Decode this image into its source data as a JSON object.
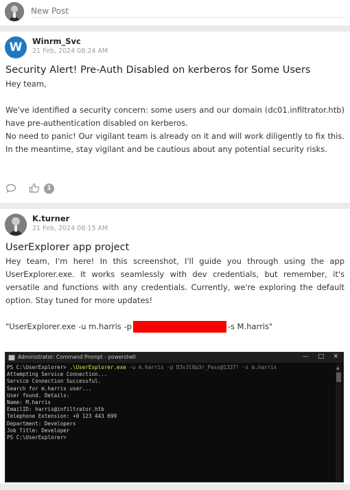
{
  "new_post": {
    "placeholder": "New Post"
  },
  "posts": [
    {
      "author": "Winrm_Svc",
      "avatar_letter": "W",
      "time": "21 Feb, 2024 08:24 AM",
      "title": "Security Alert! Pre-Auth Disabled on kerberos for Some Users",
      "body": [
        "Hey team,",
        "",
        "We've identified a security concern: some users and our domain (dc01.infiltrator.htb) have pre-authentication disabled on kerberos.",
        "No need to panic! Our vigilant team is already on it and will work diligently to fix this. In the meantime, stay vigilant and be cautious about any potential security risks."
      ],
      "likes": "1"
    },
    {
      "author": "K.turner",
      "time": "21 Feb, 2024 08:15 AM",
      "title": "UserExplorer app project",
      "body": [
        "Hey team, I'm here! In this screenshot, I'll guide you through using the app UserExplorer.exe. It works seamlessly with dev credentials, but remember, it's versatile and functions with any credentials. Currently, we're exploring the default option. Stay tuned for more updates!"
      ],
      "command_before": "\"UserExplorer.exe -u m.harris -p",
      "command_after": "-s M.harris\"",
      "terminal": {
        "window_title": "Administrator: Command Prompt - powershell",
        "prompt": "PS C:\\UserExplorer> ",
        "command": ".\\UserExplorer.exe -u m.harris -p D3v3l0p3r_Pass@1337! -s m.harris",
        "cmd_exe": ".\\UserExplorer.exe",
        "cmd_args_dim": " -u m.harris -p D3v3l0p3r_Pass@1337! -s m.harris",
        "output": [
          "Attempting Service Connection...",
          "Service Connection Successful.",
          "Search for m.harris user...",
          "User found. Details:",
          "Name: M.harris",
          "EmailID: harris@infiltrator.htb",
          "Telephone Extension: +0 123 443 699",
          "Department: Developers",
          "Job Title: Developer",
          "PS C:\\UserExplorer>"
        ]
      }
    }
  ],
  "colors": {
    "accent": "#1f78c1",
    "redaction": "#ff0000",
    "terminal_bg": "#0c0c0c"
  }
}
